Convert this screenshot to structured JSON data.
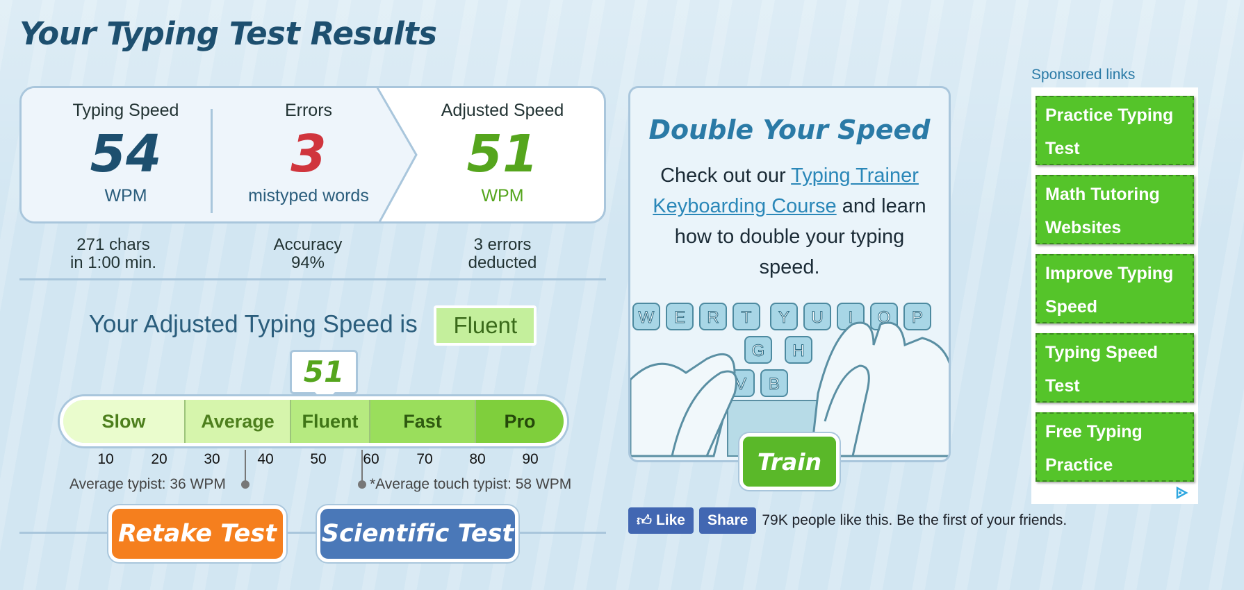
{
  "page_title": "Your Typing Test Results",
  "results": {
    "typing_speed": {
      "label": "Typing Speed",
      "value": "54",
      "unit": "WPM",
      "color": "#1d4f6f"
    },
    "errors": {
      "label": "Errors",
      "value": "3",
      "unit": "mistyped words",
      "color": "#d0353d"
    },
    "adjusted_speed": {
      "label": "Adjusted Speed",
      "value": "51",
      "unit": "WPM",
      "color": "#55a51d"
    }
  },
  "details": {
    "chars_line1": "271 chars",
    "chars_line2": "in 1:00 min.",
    "accuracy_line1": "Accuracy",
    "accuracy_line2": "94%",
    "deducted_line1": "3 errors",
    "deducted_line2": "deducted"
  },
  "rating": {
    "prefix": "Your Adjusted Typing Speed is",
    "level": "Fluent",
    "marker_value": "51"
  },
  "scale": {
    "segments": [
      {
        "label": "Slow",
        "bg": "#eafccd",
        "color": "#4d7f1d"
      },
      {
        "label": "Average",
        "bg": "#d6f5ac",
        "color": "#4d7f1d"
      },
      {
        "label": "Fluent",
        "bg": "#b6ea80",
        "color": "#3f7516"
      },
      {
        "label": "Fast",
        "bg": "#9ade5c",
        "color": "#2f5a10"
      },
      {
        "label": "Pro",
        "bg": "#7fcf3c",
        "color": "#25490a"
      }
    ],
    "ticks": [
      "10",
      "20",
      "30",
      "40",
      "50",
      "60",
      "70",
      "80",
      "90"
    ],
    "average_note": "Average typist: 36 WPM",
    "touch_note": "*Average touch typist: 58 WPM"
  },
  "buttons": {
    "retake": "Retake Test",
    "scientific": "Scientific Test",
    "retake_color": "#f57f1e",
    "scientific_color": "#4a78b8"
  },
  "promo": {
    "heading": "Double Your Speed",
    "text_before": "Check out our ",
    "link_text": "Typing Trainer Keyboarding Course",
    "text_after": " and learn how to double your typing speed.",
    "keys_top": [
      "W",
      "E",
      "R",
      "T",
      "Y",
      "U",
      "I",
      "O",
      "P"
    ],
    "keys_mid": [
      "G",
      "H"
    ],
    "keys_bot": [
      "V",
      "B"
    ],
    "train_label": "Train"
  },
  "social": {
    "like_label": "Like",
    "share_label": "Share",
    "text": "79K people like this. Be the first of your friends."
  },
  "ads": {
    "label": "Sponsored links",
    "items": [
      {
        "line1": "Practice Typing",
        "line2": "Test"
      },
      {
        "line1": "Math Tutoring",
        "line2": "Websites"
      },
      {
        "line1": "Improve Typing",
        "line2": "Speed"
      },
      {
        "line1": "Typing Speed",
        "line2": "Test"
      },
      {
        "line1": "Free Typing",
        "line2": "Practice"
      }
    ]
  }
}
